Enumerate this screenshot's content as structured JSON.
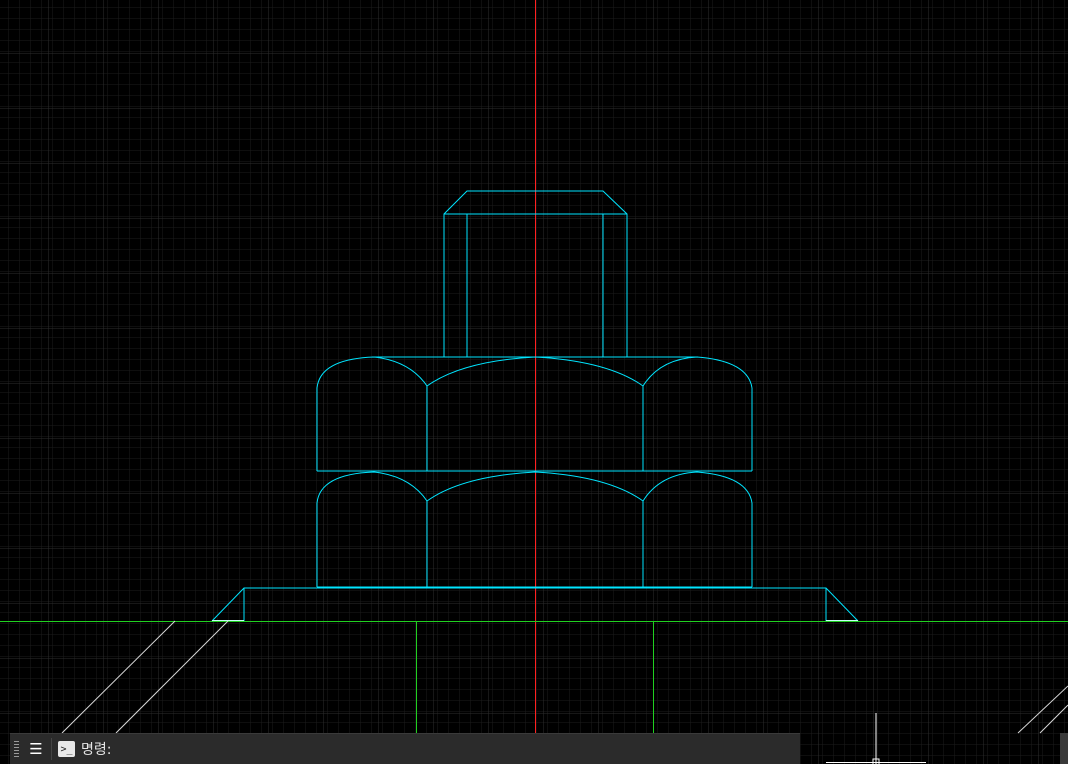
{
  "command_line": {
    "prompt_icon": ">_",
    "label": "명령:",
    "menu_icon": "menu-icon",
    "grip_icon": "grip-icon"
  },
  "colors": {
    "background": "#000000",
    "grid_minor": "#1c1c1c",
    "grid_major": "#2e2e2e",
    "axis_y": "#ff2020",
    "axis_x": "#20d020",
    "geometry": "#00e5ff",
    "aux_lines": "#d8d8d8"
  }
}
